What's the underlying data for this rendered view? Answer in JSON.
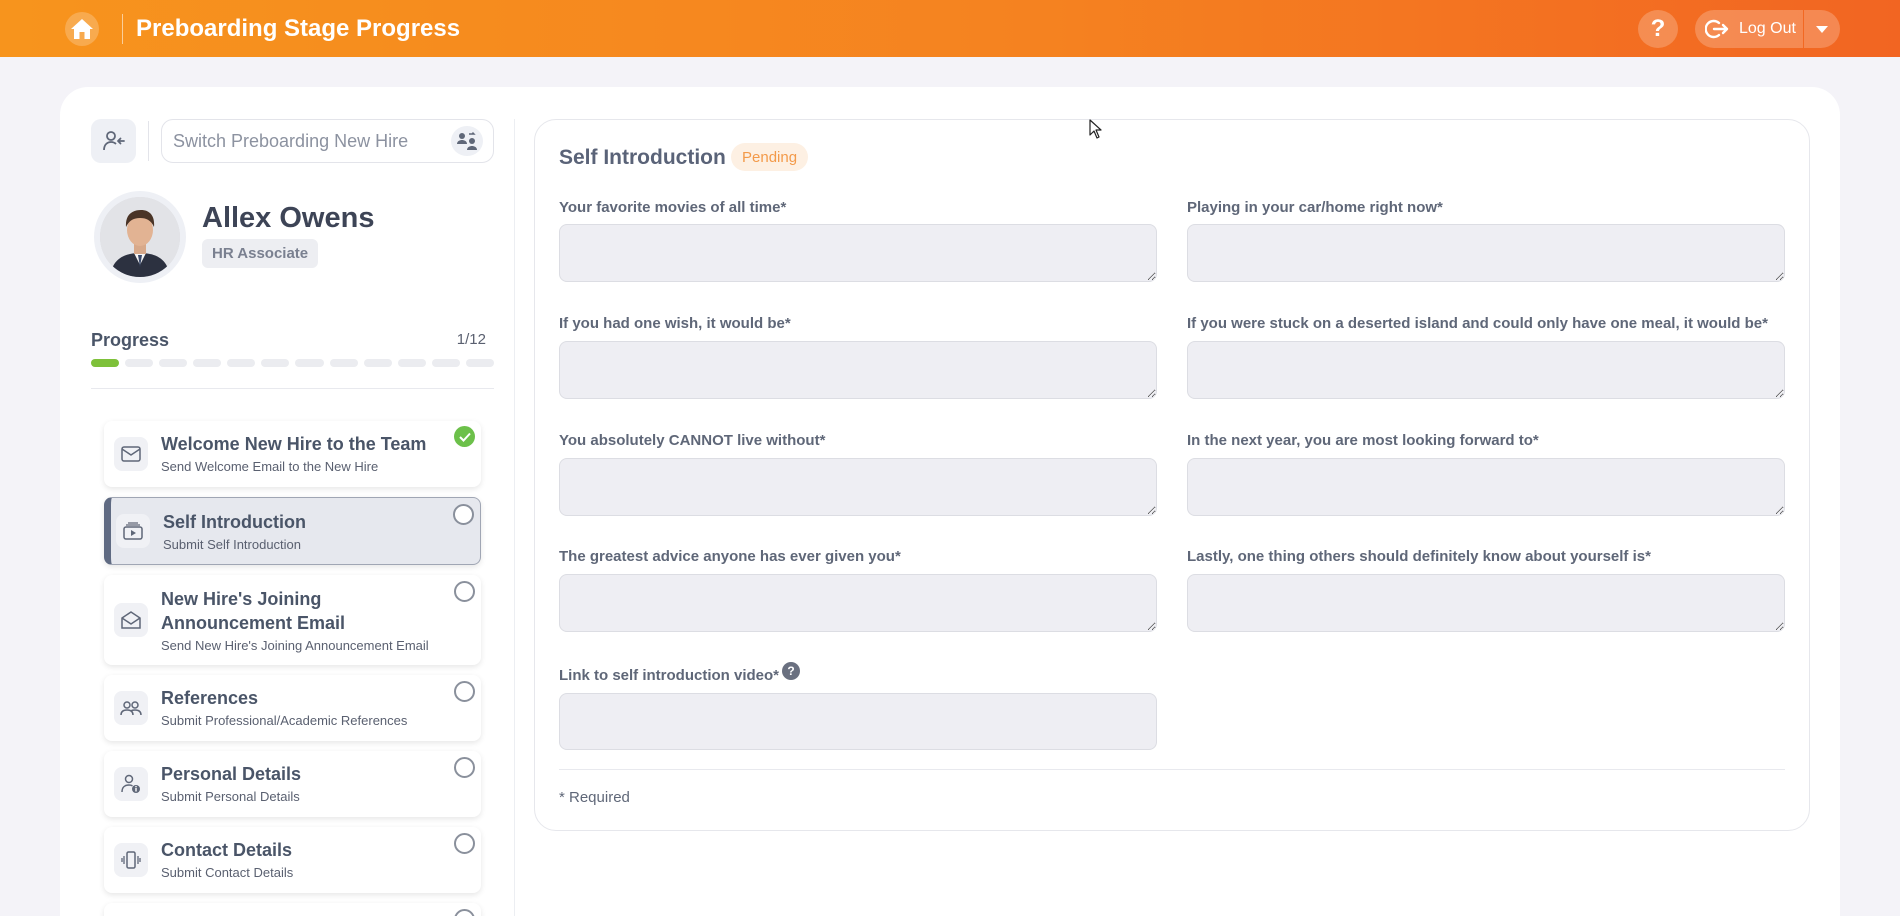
{
  "header": {
    "title": "Preboarding Stage Progress",
    "help_label": "?",
    "logout_label": "Log Out"
  },
  "switcher": {
    "placeholder": "Switch Preboarding New Hire"
  },
  "profile": {
    "name": "Allex Owens",
    "role": "HR Associate"
  },
  "progress": {
    "label": "Progress",
    "count": "1/12",
    "completed": 1,
    "total": 12
  },
  "steps": [
    {
      "title": "Welcome New Hire to the Team",
      "subtitle": "Send Welcome Email to the New Hire",
      "icon": "mail-icon",
      "status": "done"
    },
    {
      "title": "Self Introduction",
      "subtitle": "Submit Self Introduction",
      "icon": "video-stack-icon",
      "status": "active"
    },
    {
      "title": "New Hire's Joining Announcement Email",
      "subtitle": "Send New Hire's Joining Announcement Email",
      "icon": "open-envelope-icon",
      "status": "pending"
    },
    {
      "title": "References",
      "subtitle": "Submit Professional/Academic References",
      "icon": "people-icon",
      "status": "pending"
    },
    {
      "title": "Personal Details",
      "subtitle": "Submit Personal Details",
      "icon": "person-info-icon",
      "status": "pending"
    },
    {
      "title": "Contact Details",
      "subtitle": "Submit Contact Details",
      "icon": "phone-vibrate-icon",
      "status": "pending"
    }
  ],
  "form": {
    "title": "Self Introduction",
    "status": "Pending",
    "fields": {
      "movies": {
        "label": "Your favorite movies of all time*",
        "value": ""
      },
      "playing": {
        "label": "Playing in your car/home right now*",
        "value": ""
      },
      "wish": {
        "label": "If you had one wish, it would be*",
        "value": ""
      },
      "island": {
        "label": "If you were stuck on a deserted island and could only have one meal, it would be*",
        "value": ""
      },
      "cannot_live": {
        "label": "You absolutely CANNOT live without*",
        "value": ""
      },
      "next_year": {
        "label": "In the next year, you are most looking forward to*",
        "value": ""
      },
      "advice": {
        "label": "The greatest advice anyone has ever given you*",
        "value": ""
      },
      "lastly": {
        "label": "Lastly, one thing others should definitely know about yourself is*",
        "value": ""
      },
      "video_link": {
        "label": "Link to self introduction video*",
        "value": ""
      }
    },
    "help_tip": "?",
    "required_note": "* Required"
  },
  "colors": {
    "header_gradient_start": "#f7941d",
    "header_gradient_end": "#f26522",
    "progress_done": "#7ec13a",
    "check_green": "#6cc04a",
    "pending_text": "#f39a4a",
    "pending_bg": "#fdf0e3"
  }
}
